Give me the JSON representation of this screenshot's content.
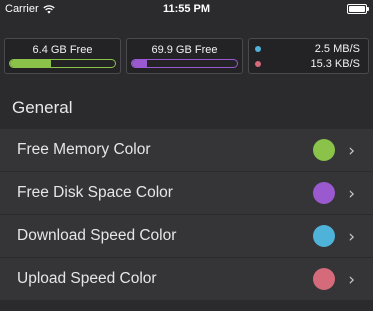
{
  "status_bar": {
    "carrier": "Carrier",
    "time": "11:55 PM",
    "wifi_icon": "wifi-icon",
    "battery_icon": "battery-icon"
  },
  "widgets": {
    "memory": {
      "label": "6.4 GB Free",
      "fill_fraction": 0.39,
      "color": "#8ac24a"
    },
    "disk": {
      "label": "69.9 GB Free",
      "fill_fraction": 0.14,
      "color": "#9b59d0"
    },
    "network": {
      "download": {
        "value": "2.5 MB/S",
        "color": "#4fb3d9"
      },
      "upload": {
        "value": "15.3 KB/S",
        "color": "#d46a7a"
      }
    }
  },
  "section": {
    "title": "General"
  },
  "rows": [
    {
      "label": "Free Memory Color",
      "color": "#8ac24a"
    },
    {
      "label": "Free Disk Space Color",
      "color": "#9b59d0"
    },
    {
      "label": "Download Speed Color",
      "color": "#4fb3d9"
    },
    {
      "label": "Upload Speed Color",
      "color": "#d46a7a"
    }
  ],
  "chevron_icon": "chevron-right-icon"
}
